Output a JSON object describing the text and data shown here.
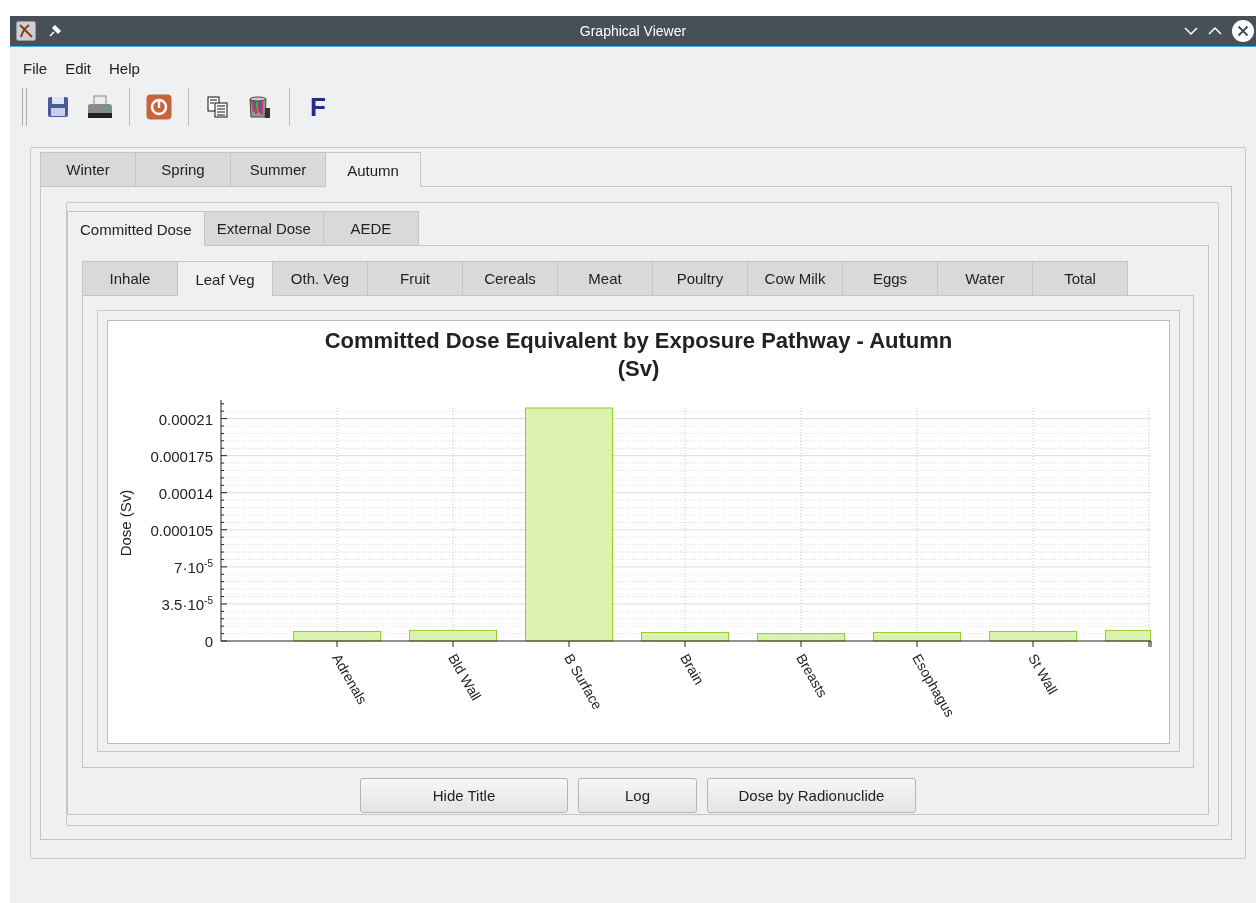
{
  "window": {
    "title": "Graphical Viewer"
  },
  "menu": [
    "File",
    "Edit",
    "Help"
  ],
  "toolbar": {
    "font_button": "F"
  },
  "season_tabs": [
    {
      "label": "Winter",
      "selected": false
    },
    {
      "label": "Spring",
      "selected": false
    },
    {
      "label": "Summer",
      "selected": false
    },
    {
      "label": "Autumn",
      "selected": true
    }
  ],
  "dose_tabs": [
    {
      "label": "Committed Dose",
      "selected": true
    },
    {
      "label": "External Dose",
      "selected": false
    },
    {
      "label": "AEDE",
      "selected": false
    }
  ],
  "pathway_tabs": [
    {
      "label": "Inhale",
      "selected": false
    },
    {
      "label": "Leaf Veg",
      "selected": true
    },
    {
      "label": "Oth. Veg",
      "selected": false
    },
    {
      "label": "Fruit",
      "selected": false
    },
    {
      "label": "Cereals",
      "selected": false
    },
    {
      "label": "Meat",
      "selected": false
    },
    {
      "label": "Poultry",
      "selected": false
    },
    {
      "label": "Cow Milk",
      "selected": false
    },
    {
      "label": "Eggs",
      "selected": false
    },
    {
      "label": "Water",
      "selected": false
    },
    {
      "label": "Total",
      "selected": false
    }
  ],
  "chart": {
    "chart_data": {
      "type": "bar",
      "title": "Committed Dose Equivalent by Exposure Pathway - Autumn\n(Sv)",
      "ylabel": "Dose (Sv)",
      "categories": [
        "Adrenals",
        "Bld Wall",
        "B Surface",
        "Brain",
        "Breasts",
        "Esophagus",
        "St Wall",
        null
      ],
      "series": [
        {
          "color": "#dcf3b0",
          "values": [
            9e-06,
            1e-05,
            0.00022,
            8e-06,
            7e-06,
            8e-06,
            9e-06,
            1e-05
          ]
        }
      ],
      "grid": true,
      "ylim": [
        0,
        0.00022
      ],
      "yticks": [
        {
          "value": 0,
          "label": "0"
        },
        {
          "value": 3.5e-05,
          "label": "3.5·10$^{-5}$"
        },
        {
          "value": 7e-05,
          "label": "7·10$^{-5}$"
        },
        {
          "value": 0.000105,
          "label": "0.000105"
        },
        {
          "value": 0.00014,
          "label": "0.00014"
        },
        {
          "value": 0.000175,
          "label": "0.000175"
        },
        {
          "value": 0.00021,
          "label": "0.00021"
        }
      ]
    }
  },
  "buttons": [
    "Hide Title",
    "Log",
    "Dose by Radionuclide"
  ]
}
